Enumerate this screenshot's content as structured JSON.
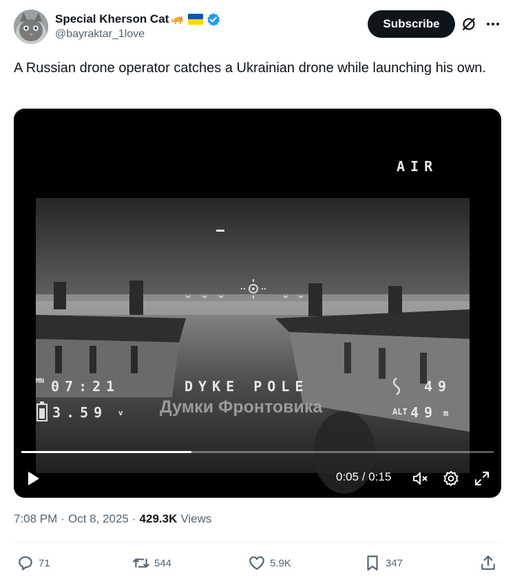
{
  "author": {
    "display_name": "Special Kherson Cat",
    "emojis": [
      "cat-emoji",
      "ukraine-flag-emoji"
    ],
    "verified": true,
    "handle": "@bayraktar_1love"
  },
  "subscribe_label": "Subscribe",
  "tweet_text": "A Russian drone operator catches a Ukrainian drone while launching his own.",
  "video": {
    "osd": {
      "mode": "AIR",
      "timer": "07:21",
      "call_sign": "DYKE POLE",
      "satellites": "49",
      "voltage": "3.59",
      "voltage_unit": "v",
      "altitude": "49",
      "altitude_unit": "m",
      "alt_label": "ALT",
      "timer_label": "MN"
    },
    "watermark": "Думки Фронтовика",
    "current_time": "0:05",
    "duration": "0:15",
    "time_display": "0:05 / 0:15",
    "progress": 0.36
  },
  "meta": {
    "time": "7:08 PM",
    "date": "Oct 8, 2025",
    "views_count": "429.3K",
    "views_label": "Views"
  },
  "actions": {
    "replies": "71",
    "reposts": "544",
    "likes": "5.9K",
    "bookmarks": "347"
  },
  "colors": {
    "text": "#0f1419",
    "secondary": "#536471",
    "verified": "#1d9bf0"
  }
}
